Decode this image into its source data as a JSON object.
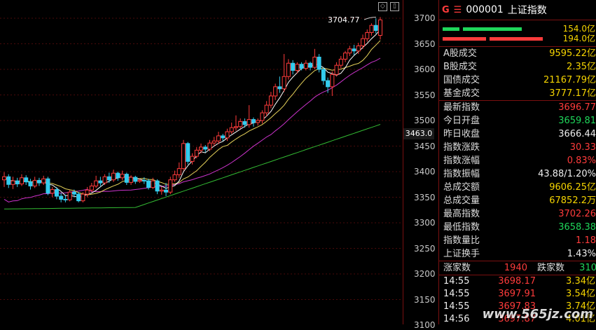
{
  "chart": {
    "peak_label": "3704.77",
    "current_price_tag": "3463.0",
    "y_ticks": [
      "3700",
      "3650",
      "3600",
      "3550",
      "3500",
      "3450",
      "3400",
      "3350",
      "3300",
      "3250",
      "3200",
      "3150",
      "3100"
    ],
    "colors": {
      "up": "#ff3b3b",
      "down": "#33ccee",
      "ma5": "#ffffff",
      "ma10": "#e6d25a",
      "ma20": "#cc33cc",
      "ma60": "#33bb33",
      "grid": "#4a0a0a"
    },
    "candles": [
      [
        3384,
        3390,
        3370,
        3399
      ],
      [
        3390,
        3375,
        3368,
        3395
      ],
      [
        3375,
        3382,
        3366,
        3390
      ],
      [
        3382,
        3376,
        3370,
        3388
      ],
      [
        3376,
        3388,
        3372,
        3395
      ],
      [
        3388,
        3380,
        3374,
        3393
      ],
      [
        3380,
        3372,
        3365,
        3386
      ],
      [
        3372,
        3383,
        3368,
        3390
      ],
      [
        3383,
        3378,
        3372,
        3388
      ],
      [
        3378,
        3386,
        3374,
        3392
      ],
      [
        3386,
        3358,
        3354,
        3390
      ],
      [
        3358,
        3365,
        3350,
        3370
      ],
      [
        3365,
        3352,
        3346,
        3370
      ],
      [
        3352,
        3346,
        3340,
        3358
      ],
      [
        3346,
        3345,
        3340,
        3355
      ],
      [
        3345,
        3360,
        3342,
        3364
      ],
      [
        3360,
        3356,
        3350,
        3365
      ],
      [
        3356,
        3343,
        3340,
        3360
      ],
      [
        3343,
        3356,
        3340,
        3360
      ],
      [
        3356,
        3364,
        3350,
        3370
      ],
      [
        3364,
        3372,
        3360,
        3378
      ],
      [
        3372,
        3382,
        3368,
        3392
      ],
      [
        3382,
        3378,
        3372,
        3390
      ],
      [
        3378,
        3390,
        3374,
        3395
      ],
      [
        3390,
        3384,
        3378,
        3398
      ],
      [
        3384,
        3397,
        3380,
        3404
      ],
      [
        3397,
        3388,
        3382,
        3400
      ],
      [
        3388,
        3395,
        3383,
        3402
      ],
      [
        3395,
        3379,
        3374,
        3398
      ],
      [
        3379,
        3389,
        3374,
        3393
      ],
      [
        3389,
        3381,
        3376,
        3392
      ],
      [
        3381,
        3383,
        3378,
        3386
      ],
      [
        3383,
        3382,
        3376,
        3389
      ],
      [
        3382,
        3369,
        3365,
        3386
      ],
      [
        3369,
        3382,
        3366,
        3388
      ],
      [
        3382,
        3362,
        3356,
        3385
      ],
      [
        3362,
        3364,
        3355,
        3370
      ],
      [
        3364,
        3360,
        3352,
        3378
      ],
      [
        3360,
        3384,
        3356,
        3390
      ],
      [
        3384,
        3394,
        3380,
        3402
      ],
      [
        3394,
        3406,
        3388,
        3418
      ],
      [
        3406,
        3455,
        3402,
        3462
      ],
      [
        3455,
        3420,
        3414,
        3458
      ],
      [
        3420,
        3430,
        3414,
        3436
      ],
      [
        3430,
        3442,
        3426,
        3448
      ],
      [
        3442,
        3448,
        3436,
        3455
      ],
      [
        3448,
        3444,
        3438,
        3452
      ],
      [
        3444,
        3456,
        3440,
        3462
      ],
      [
        3456,
        3460,
        3450,
        3468
      ],
      [
        3460,
        3470,
        3454,
        3478
      ],
      [
        3470,
        3466,
        3460,
        3474
      ],
      [
        3466,
        3478,
        3460,
        3484
      ],
      [
        3478,
        3486,
        3474,
        3496
      ],
      [
        3486,
        3488,
        3480,
        3510
      ],
      [
        3488,
        3498,
        3484,
        3504
      ],
      [
        3498,
        3492,
        3486,
        3504
      ],
      [
        3492,
        3502,
        3486,
        3530
      ],
      [
        3502,
        3496,
        3488,
        3506
      ],
      [
        3496,
        3500,
        3490,
        3504
      ],
      [
        3500,
        3515,
        3494,
        3520
      ],
      [
        3515,
        3530,
        3508,
        3538
      ],
      [
        3530,
        3548,
        3524,
        3556
      ],
      [
        3548,
        3566,
        3540,
        3572
      ],
      [
        3566,
        3562,
        3554,
        3586
      ],
      [
        3562,
        3586,
        3556,
        3630
      ],
      [
        3586,
        3612,
        3580,
        3620
      ],
      [
        3612,
        3598,
        3590,
        3618
      ],
      [
        3598,
        3610,
        3592,
        3614
      ],
      [
        3610,
        3602,
        3598,
        3614
      ],
      [
        3602,
        3612,
        3598,
        3618
      ],
      [
        3612,
        3604,
        3598,
        3615
      ],
      [
        3604,
        3624,
        3600,
        3640
      ],
      [
        3624,
        3600,
        3594,
        3630
      ],
      [
        3600,
        3578,
        3570,
        3604
      ],
      [
        3578,
        3566,
        3554,
        3584
      ],
      [
        3566,
        3590,
        3548,
        3596
      ],
      [
        3590,
        3608,
        3586,
        3614
      ],
      [
        3608,
        3620,
        3602,
        3626
      ],
      [
        3620,
        3632,
        3614,
        3636
      ],
      [
        3632,
        3640,
        3626,
        3646
      ],
      [
        3640,
        3636,
        3628,
        3648
      ],
      [
        3636,
        3646,
        3630,
        3652
      ],
      [
        3646,
        3660,
        3640,
        3668
      ],
      [
        3660,
        3672,
        3654,
        3678
      ],
      [
        3672,
        3686,
        3666,
        3690
      ],
      [
        3686,
        3676,
        3670,
        3700
      ],
      [
        3666.44,
        3696.77,
        3658.38,
        3702.26
      ]
    ]
  },
  "panel": {
    "header": {
      "g_label": "G",
      "menu_glyph": "☰",
      "code": "000001",
      "name": "上证指数"
    },
    "flow": [
      {
        "value": "154.0亿",
        "color": "#1fd65a"
      },
      {
        "value": "194.0亿",
        "color": "#ff3b3b"
      }
    ],
    "section1": [
      {
        "label": "A股成交",
        "value": "9595.22亿"
      },
      {
        "label": "B股成交",
        "value": "2.35亿"
      },
      {
        "label": "国债成交",
        "value": "21167.79亿"
      },
      {
        "label": "基金成交",
        "value": "3777.17亿"
      }
    ],
    "section2": [
      {
        "label": "最新指数",
        "value": "3696.77",
        "color": "red"
      },
      {
        "label": "今日开盘",
        "value": "3659.81",
        "color": "green"
      },
      {
        "label": "昨日收盘",
        "value": "3666.44",
        "color": "white"
      },
      {
        "label": "指数涨跌",
        "value": "30.33",
        "color": "red"
      },
      {
        "label": "指数涨幅",
        "value": "0.83%",
        "color": "red"
      },
      {
        "label": "指数振幅",
        "value": "43.88/1.20%",
        "color": "white"
      },
      {
        "label": "总成交额",
        "value": "9606.25亿",
        "color": "yellow"
      },
      {
        "label": "总成交量",
        "value": "67852.2万",
        "color": "yellow"
      },
      {
        "label": "最高指数",
        "value": "3702.26",
        "color": "red"
      },
      {
        "label": "最低指数",
        "value": "3658.38",
        "color": "green"
      },
      {
        "label": "指数量比",
        "value": "1.18",
        "color": "red"
      },
      {
        "label": "上证换手",
        "value": "1.43%",
        "color": "white"
      }
    ],
    "updown": {
      "up_label": "涨家数",
      "up_value": "1940",
      "down_label": "跌家数",
      "down_value": "310"
    },
    "trades": [
      {
        "time": "14:55",
        "price": "3698.17",
        "amount": "3.34亿"
      },
      {
        "time": "14:55",
        "price": "3697.91",
        "amount": "3.54亿"
      },
      {
        "time": "14:55",
        "price": "3697.83",
        "amount": "3.74亿"
      },
      {
        "time": "14:56",
        "price": "3697.87",
        "amount": "4.01亿"
      }
    ]
  },
  "watermark": "www.565jz.com"
}
